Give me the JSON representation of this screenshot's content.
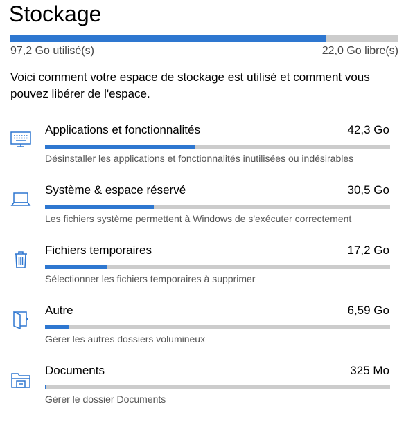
{
  "page": {
    "title": "Stockage",
    "used_label": "97,2 Go utilisé(s)",
    "free_label": "22,0 Go libre(s)",
    "used_fraction": 0.815,
    "intro": "Voici comment votre espace de stockage est utilisé et comment vous pouvez libérer de l'espace."
  },
  "colors": {
    "accent": "#2e77d0",
    "track": "#cccccc"
  },
  "items": [
    {
      "icon": "keyboard-monitor-icon",
      "name": "Applications et fonctionnalités",
      "size": "42,3 Go",
      "fraction": 0.435,
      "description": "Désinstaller les applications et fonctionnalités inutilisées ou indésirables"
    },
    {
      "icon": "laptop-icon",
      "name": "Système & espace réservé",
      "size": "30,5 Go",
      "fraction": 0.315,
      "description": "Les fichiers système permettent à Windows de s'exécuter correctement"
    },
    {
      "icon": "trash-icon",
      "name": "Fichiers temporaires",
      "size": "17,2 Go",
      "fraction": 0.178,
      "description": "Sélectionner les fichiers temporaires à supprimer"
    },
    {
      "icon": "folder-open-icon",
      "name": "Autre",
      "size": "6,59 Go",
      "fraction": 0.068,
      "description": "Gérer les autres dossiers volumineux"
    },
    {
      "icon": "documents-folder-icon",
      "name": "Documents",
      "size": "325 Mo",
      "fraction": 0.004,
      "description": "Gérer le dossier Documents"
    }
  ]
}
